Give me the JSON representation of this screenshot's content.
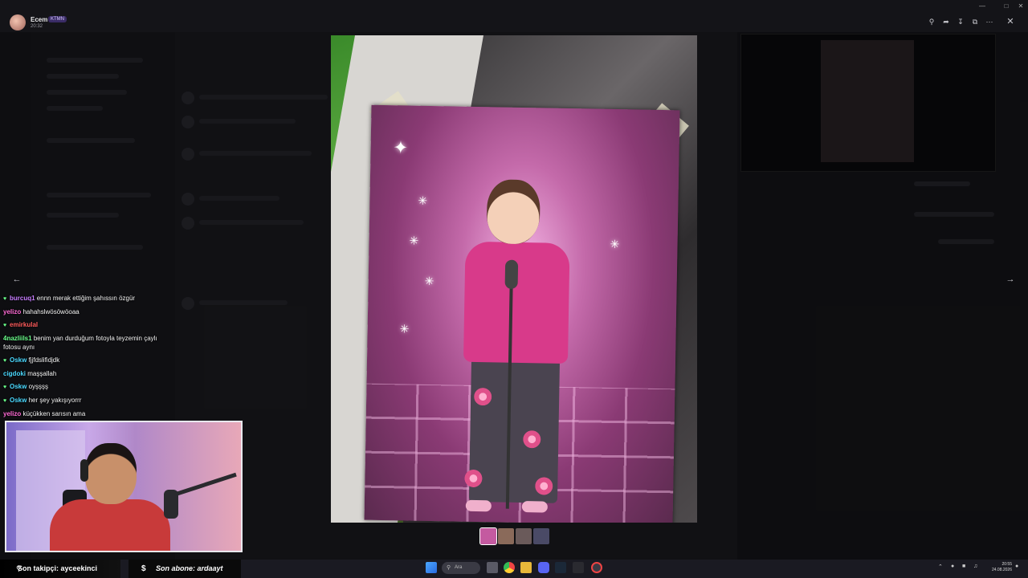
{
  "viewer": {
    "username": "Ecem",
    "badge": "KTMN",
    "time": "20:32"
  },
  "header_icons": [
    "zoom-icon",
    "share-icon",
    "download-icon",
    "open-external-icon",
    "more-icon",
    "close-icon"
  ],
  "chat": {
    "messages": [
      {
        "user": "burcuq1",
        "user_color": "#c77dff",
        "icon": "heart-icon",
        "text": "ennn merak ettiğim şahıssın özgür"
      },
      {
        "user": "yelizo",
        "user_color": "#ff6ad5",
        "icon": "",
        "text": "hahahslwösöwöoaa"
      },
      {
        "user": "emirkulal",
        "user_color": "#ff5c5c",
        "icon": "heart-icon",
        "text": ""
      },
      {
        "user": "4nazliils1",
        "user_color": "#6aff8a",
        "icon": "",
        "text": "benim yan durduğum fotoyla teyzemin çaylı fotosu aynı"
      },
      {
        "user": "Oskw",
        "user_color": "#4ad9ff",
        "icon": "heart-icon",
        "text": "fjjfdslifidjdk"
      },
      {
        "user": "cigdoki",
        "user_color": "#4ad9ff",
        "icon": "",
        "text": "maşşallah"
      },
      {
        "user": "Oskw",
        "user_color": "#4ad9ff",
        "icon": "heart-icon",
        "text": "oyşşşş"
      },
      {
        "user": "Oskw",
        "user_color": "#4ad9ff",
        "icon": "heart-icon",
        "text": "her şey yakışıyorrr"
      },
      {
        "user": "yelizo",
        "user_color": "#ff6ad5",
        "icon": "",
        "text": "küçükken sarısın ama"
      }
    ]
  },
  "stream_bar": {
    "follower_label": "Son takipçi: ayceekinci",
    "sub_label": "Son abone: ardaayt"
  },
  "taskbar": {
    "search_placeholder": "Ara",
    "clock_time": "20:55",
    "clock_date": "24.08.2026"
  },
  "colors": {
    "accent_purple": "#c77dff",
    "background": "#121217"
  }
}
